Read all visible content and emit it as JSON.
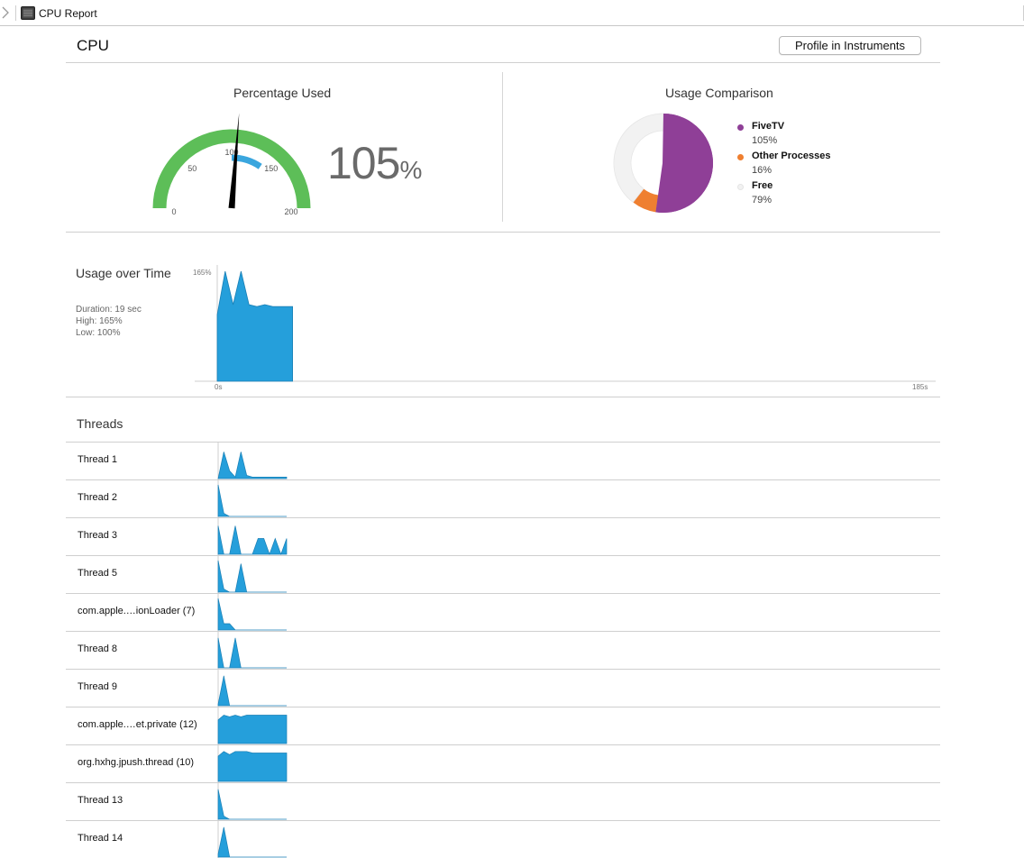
{
  "window": {
    "title": "CPU Report"
  },
  "header": {
    "title": "CPU",
    "profile_button": "Profile in Instruments"
  },
  "percentage_used": {
    "title": "Percentage Used",
    "value": "105",
    "unit": "%",
    "gauge_value": 105,
    "gauge_max": 200,
    "gauge_labels": [
      "0",
      "50",
      "100",
      "150",
      "200"
    ],
    "colors": {
      "track": "#5dbe58",
      "inner": "#3aa6de",
      "needle": "#000000"
    }
  },
  "usage_comparison": {
    "title": "Usage Comparison",
    "items": [
      {
        "name": "FiveTV",
        "value": "105%",
        "share": 52.5,
        "color": "#8f3f97"
      },
      {
        "name": "Other Processes",
        "value": "16%",
        "share": 8,
        "color": "#ef7f30"
      },
      {
        "name": "Free",
        "value": "79%",
        "share": 39.5,
        "color": "#f2f2f2"
      }
    ]
  },
  "usage_over_time": {
    "title": "Usage over Time",
    "duration": "Duration: 19 sec",
    "high": "High: 165%",
    "low": "Low: 100%",
    "y_label": "165%",
    "x_start_label": "0s",
    "x_end_label": "185s",
    "fill_color": "#259fdb"
  },
  "chart_data": {
    "type": "area",
    "title": "Usage over Time",
    "x": [
      0,
      2,
      4,
      6,
      8,
      10,
      12,
      14,
      16,
      19
    ],
    "y": [
      100,
      165,
      115,
      165,
      115,
      112,
      115,
      112,
      112,
      112
    ],
    "xlim": [
      0,
      185
    ],
    "ylim": [
      0,
      165
    ],
    "xlabel": "",
    "ylabel": ""
  },
  "threads": {
    "title": "Threads",
    "rows": [
      {
        "name": "Thread 1",
        "series": [
          0,
          0.85,
          0.25,
          0.05,
          0.85,
          0.1,
          0.05,
          0.05,
          0.05,
          0.05,
          0.05,
          0.05,
          0.05
        ]
      },
      {
        "name": "Thread 2",
        "series": [
          1,
          0.1,
          0,
          0,
          0,
          0,
          0,
          0,
          0,
          0,
          0,
          0,
          0
        ]
      },
      {
        "name": "Thread 3",
        "series": [
          0.9,
          0,
          0,
          0.9,
          0,
          0,
          0,
          0.5,
          0.5,
          0,
          0.5,
          0,
          0.5
        ]
      },
      {
        "name": "Thread 5",
        "series": [
          1,
          0.1,
          0,
          0,
          0.9,
          0,
          0,
          0,
          0,
          0,
          0,
          0,
          0
        ]
      },
      {
        "name": "com.apple.…ionLoader (7)",
        "series": [
          1,
          0.2,
          0.2,
          0,
          0,
          0,
          0,
          0,
          0,
          0,
          0,
          0,
          0
        ]
      },
      {
        "name": "Thread 8",
        "series": [
          0.95,
          0,
          0,
          0.95,
          0,
          0,
          0,
          0,
          0,
          0,
          0,
          0,
          0
        ]
      },
      {
        "name": "Thread 9",
        "series": [
          0.05,
          0.95,
          0,
          0,
          0,
          0,
          0,
          0,
          0,
          0,
          0,
          0,
          0
        ]
      },
      {
        "name": "com.apple.…et.private (12)",
        "series": [
          0.75,
          0.9,
          0.85,
          0.9,
          0.85,
          0.9,
          0.9,
          0.9,
          0.9,
          0.9,
          0.9,
          0.9,
          0.9
        ]
      },
      {
        "name": "org.hxhg.jpush.thread (10)",
        "series": [
          0.8,
          0.95,
          0.85,
          0.95,
          0.95,
          0.95,
          0.9,
          0.9,
          0.9,
          0.9,
          0.9,
          0.9,
          0.9
        ]
      },
      {
        "name": "Thread 13",
        "series": [
          0.95,
          0.1,
          0,
          0,
          0,
          0,
          0,
          0,
          0,
          0,
          0,
          0,
          0
        ]
      },
      {
        "name": "Thread 14",
        "series": [
          0.1,
          0.95,
          0,
          0,
          0,
          0,
          0,
          0,
          0,
          0,
          0,
          0,
          0
        ]
      }
    ]
  }
}
